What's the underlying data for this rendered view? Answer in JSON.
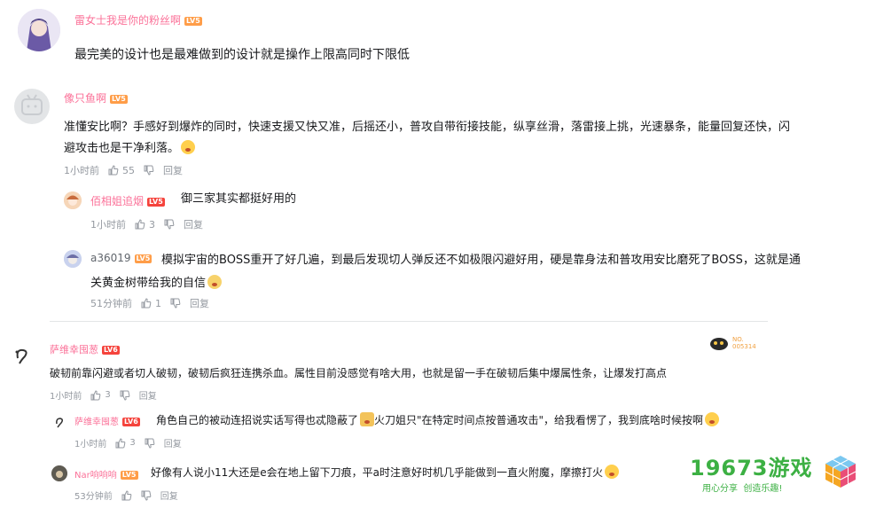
{
  "comments": [
    {
      "user": "雷女士我是你的粉丝啊",
      "level": "LV5",
      "text": "最完美的设计也是最难做到的设计就是操作上限高同时下限低"
    },
    {
      "user": "像只鱼啊",
      "level": "LV5",
      "text_line1": "准懂安比啊？手感好到爆炸的同时，快速支援又快又准，后摇还小，普攻自带衔接技能，纵享丝滑，落雷接上挑，光速暴条，能量回复还快，闪",
      "text_line2": "避攻击也是干净利落。",
      "time": "1小时前",
      "likes": "55",
      "reply": "回复",
      "replies": [
        {
          "user": "佰相姐追烟",
          "level": "LV5",
          "text": "御三家其实都挺好用的",
          "time": "1小时前",
          "likes": "3",
          "reply": "回复"
        },
        {
          "user": "a36019",
          "level": "LV5",
          "text_line1": "模拟宇宙的BOSS重开了好几遍，到最后发现切人弹反还不如极限闪避好用，硬是靠身法和普攻用安比磨死了BOSS，这就是通",
          "text_line2": "关黄金树带给我的自信",
          "time": "51分钟前",
          "likes": "1",
          "reply": "回复"
        }
      ]
    },
    {
      "user": "萨维幸囤葱",
      "level": "LV6",
      "badge_no": "NO.",
      "badge_num": "005314",
      "text": "破韧前靠闪避或者切人破韧，破韧后疯狂连携杀血。属性目前没感觉有啥大用，也就是留一手在破韧后集中爆属性条，让爆发打高点",
      "time": "1小时前",
      "likes": "3",
      "reply": "回复",
      "replies": [
        {
          "user": "萨维幸囤葱",
          "level": "LV6",
          "text_a": "角色自己的被动连招说实话写得也忒隐蔽了",
          "text_b": "火刀姐只\"在特定时间点按普通攻击\"，给我看愣了，我到底啥时候按啊",
          "time": "1小时前",
          "likes": "3",
          "reply": "回复"
        },
        {
          "user": "Nar响响响",
          "level": "LV5",
          "text": "好像有人说小11大还是e会在地上留下刀痕，平a时注意好时机几乎能做到一直火附魔，摩擦打火",
          "time": "53分钟前",
          "likes": "",
          "reply": "回复"
        }
      ]
    }
  ],
  "watermark": {
    "brand": "19673游戏",
    "slogan": "用心分享  创造乐趣!"
  },
  "colors": {
    "username": "#fb7299",
    "meta": "#9499a0",
    "brand_green": "#3cb043"
  }
}
